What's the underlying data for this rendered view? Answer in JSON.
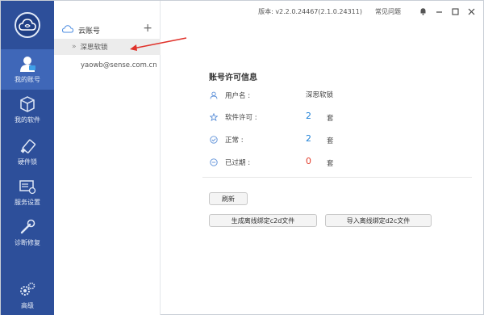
{
  "titlebar": {
    "version": "版本: v2.2.0.24467(2.1.0.24311)",
    "faq": "常见问题"
  },
  "sidebar": {
    "items": [
      {
        "label": "我的账号",
        "icon": "user-icon",
        "active": true
      },
      {
        "label": "我的软件",
        "icon": "cubes-icon",
        "active": false
      },
      {
        "label": "硬件锁",
        "icon": "usb-key-icon",
        "active": false
      },
      {
        "label": "服务设置",
        "icon": "server-settings-icon",
        "active": false
      },
      {
        "label": "诊断修复",
        "icon": "wrench-icon",
        "active": false
      },
      {
        "label": "高级",
        "icon": "gears-icon",
        "active": false
      }
    ]
  },
  "accounts": {
    "header": "云账号",
    "add_symbol": "+",
    "selected": "深思软锁",
    "email": "yaowb@sense.com.cn"
  },
  "panel": {
    "title": "账号许可信息",
    "username_label": "用户名 :",
    "username_value": "深思软锁",
    "license_label": "软件许可 :",
    "license_value": "2",
    "normal_label": "正常 :",
    "normal_value": "2",
    "expired_label": "已过期 :",
    "expired_value": "0",
    "unit": "套"
  },
  "buttons": {
    "refresh": "刷新",
    "generate_c2d": "生成离线绑定c2d文件",
    "import_d2c": "导入离线绑定d2c文件"
  },
  "colors": {
    "sidebar": "#2d4f9a",
    "sidebar_active": "#3f67b8",
    "value_blue": "#1b7fd6",
    "value_red": "#e23d2b",
    "annotation_arrow": "#e0322b"
  }
}
